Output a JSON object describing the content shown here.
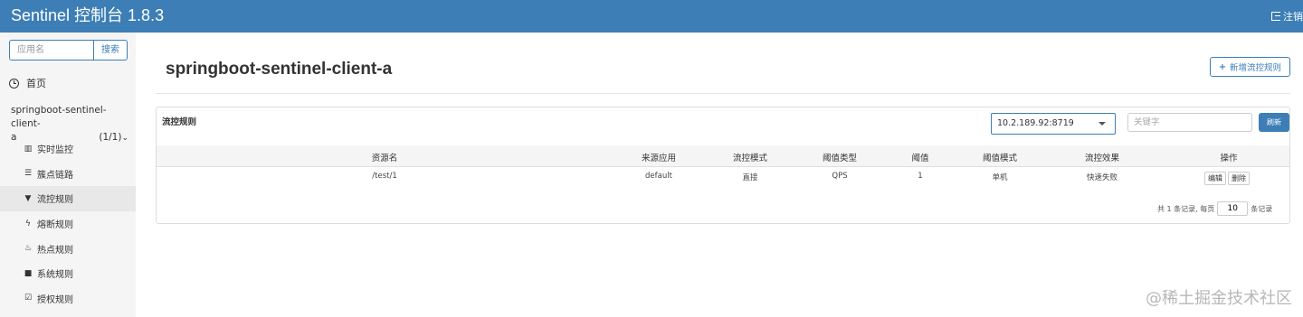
{
  "header": {
    "title": "Sentinel 控制台 1.8.3",
    "logout_label": "注销"
  },
  "sidebar": {
    "search_placeholder": "应用名",
    "search_button": "搜索",
    "home_label": "首页",
    "app_name_line1": "springboot-sentinel-client-",
    "app_name_line2": "a",
    "app_count": "(1/1)",
    "items": [
      {
        "icon": "bar-chart-icon",
        "glyph": "▥",
        "label": "实时监控",
        "active": false
      },
      {
        "icon": "list-icon",
        "glyph": "☰",
        "label": "簇点链路",
        "active": false
      },
      {
        "icon": "filter-icon",
        "glyph": "▼",
        "label": "流控规则",
        "active": true
      },
      {
        "icon": "flash-icon",
        "glyph": "ϟ",
        "label": "熔断规则",
        "active": false
      },
      {
        "icon": "fire-icon",
        "glyph": "♨",
        "label": "热点规则",
        "active": false
      },
      {
        "icon": "lock-icon",
        "glyph": "■",
        "label": "系统规则",
        "active": false
      },
      {
        "icon": "check-square-icon",
        "glyph": "☑",
        "label": "授权规则",
        "active": false
      }
    ]
  },
  "main": {
    "page_title": "springboot-sentinel-client-a",
    "add_rule_button": "新增流控规则",
    "panel_title": "流控规则",
    "machine_select_value": "10.2.189.92:8719",
    "keyword_placeholder": "关键字",
    "refresh_button": "刷新",
    "columns": [
      "资源名",
      "来源应用",
      "流控模式",
      "阈值类型",
      "阈值",
      "阈值模式",
      "流控效果",
      "操作"
    ],
    "rows": [
      {
        "resource": "/test/1",
        "limit_app": "default",
        "mode": "直接",
        "grade": "QPS",
        "count": "1",
        "cluster_mode": "单机",
        "effect": "快速失败",
        "edit": "编辑",
        "delete": "删除"
      }
    ],
    "pager_total": "共 1 条记录, 每页",
    "pager_size": "10",
    "pager_unit": "条记录"
  },
  "watermark": "@稀土掘金技术社区",
  "colors": {
    "primary": "#3c7eb5"
  }
}
